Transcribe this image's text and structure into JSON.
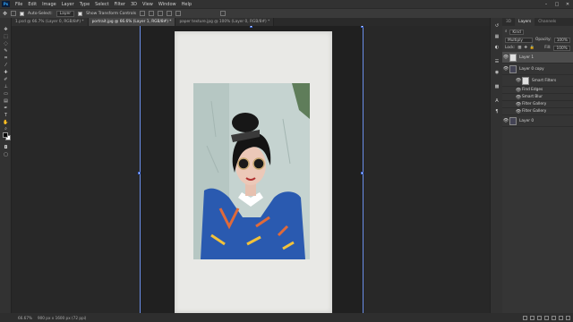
{
  "app": {
    "menu": [
      "File",
      "Edit",
      "Image",
      "Layer",
      "Type",
      "Select",
      "Filter",
      "3D",
      "View",
      "Window",
      "Help"
    ],
    "logo": "Ps",
    "window_controls": [
      "–",
      "□",
      "✕"
    ]
  },
  "options_bar": {
    "auto_select_label": "Auto-Select:",
    "auto_select_value": "Layer",
    "transform_label": "Show Transform Controls"
  },
  "tabs": [
    {
      "label": "1.psd @ 66.7% (Layer 0, RGB/8#) *",
      "active": false
    },
    {
      "label": "portrait.jpg @ 66.6% (Layer 1, RGB/8#) *",
      "active": true
    },
    {
      "label": "paper texture.jpg @ 100% (Layer 0, RGB/8#) *",
      "active": false
    }
  ],
  "status": {
    "zoom": "66.67%",
    "doc_info": "900 px x 1600 px (72 ppi)"
  },
  "panels": {
    "tabs": [
      "3D",
      "Layers",
      "Channels"
    ],
    "active_tab": "Layers",
    "filter_kind": "Kind",
    "blend_mode": "Multiply",
    "opacity_label": "Opacity:",
    "opacity_value": "100%",
    "lock_label": "Lock:",
    "fill_label": "Fill:",
    "fill_value": "100%",
    "layers": [
      {
        "name": "Layer 1",
        "selected": true
      },
      {
        "name": "Layer 0 copy",
        "selected": false
      },
      {
        "name": "Smart Filters",
        "selected": false
      },
      {
        "name": "Find Edges",
        "selected": false
      },
      {
        "name": "Smart Blur",
        "selected": false
      },
      {
        "name": "Filter Gallery",
        "selected": false
      },
      {
        "name": "Filter Gallery",
        "selected": false
      },
      {
        "name": "Layer 0",
        "selected": false
      }
    ]
  },
  "colors": {
    "ui_dark": "#282828",
    "panel": "#353535",
    "accent": "#31a8ff",
    "selection_handle": "#3a66d6"
  }
}
